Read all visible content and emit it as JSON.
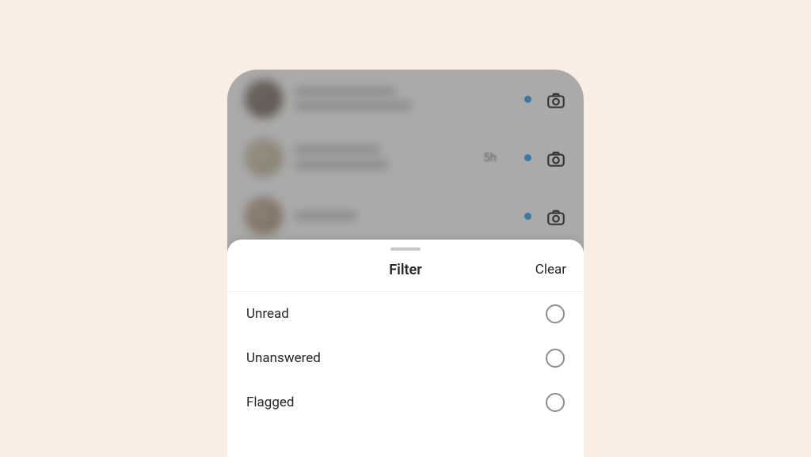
{
  "background": {
    "chats": [
      {
        "time": ""
      },
      {
        "time": "5h"
      },
      {
        "time": ""
      }
    ]
  },
  "sheet": {
    "title": "Filter",
    "clear_label": "Clear",
    "options": [
      {
        "label": "Unread"
      },
      {
        "label": "Unanswered"
      },
      {
        "label": "Flagged"
      }
    ]
  }
}
